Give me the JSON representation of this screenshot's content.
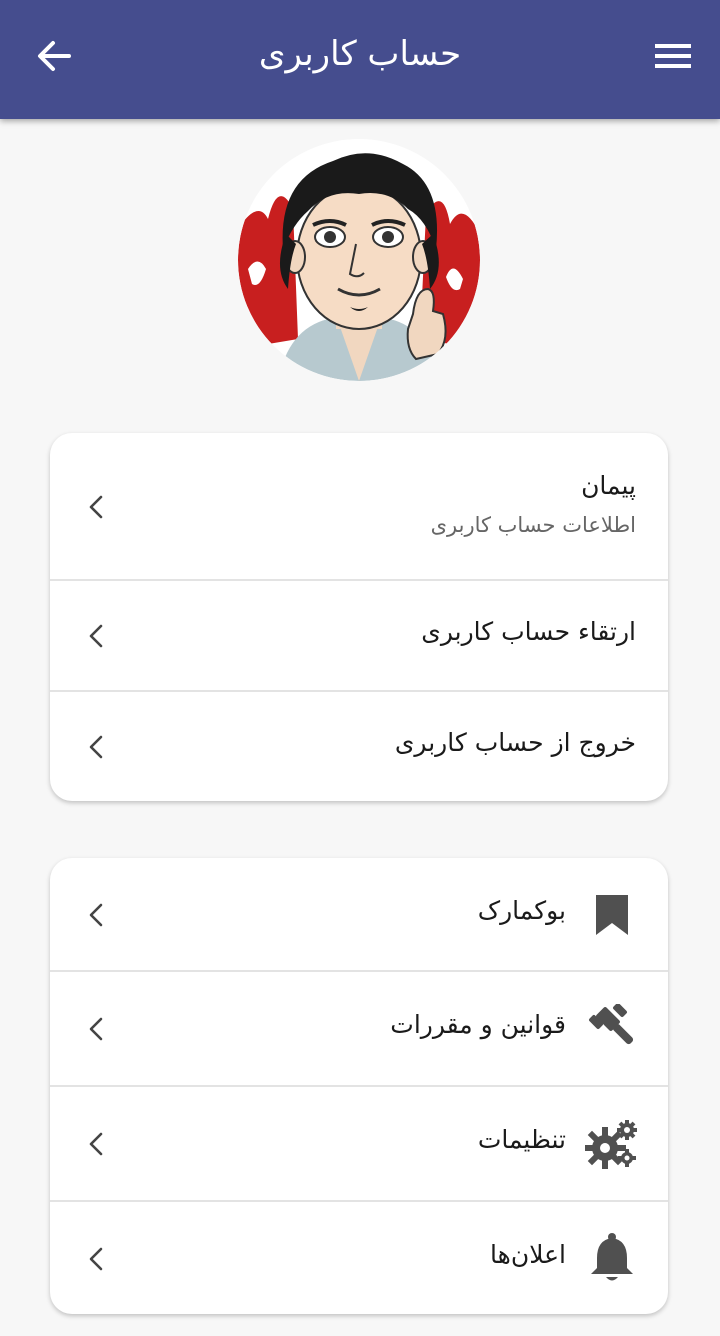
{
  "app": {
    "title": "حساب کاربری",
    "header_color": "#454d8e"
  },
  "header": {
    "back_icon": "arrow-left-icon",
    "menu_icon": "hamburger-menu-icon"
  },
  "profile": {
    "avatar": "cartoon-avatar"
  },
  "account_card": {
    "items": [
      {
        "label": "پیمان",
        "sublabel": "اطلاعات حساب کاربری",
        "chevron": "chevron-left-icon"
      },
      {
        "label": "ارتقاء حساب کاربری",
        "chevron": "chevron-left-icon"
      },
      {
        "label": "خروج از حساب کاربری",
        "chevron": "chevron-left-icon"
      }
    ]
  },
  "menu_card": {
    "items": [
      {
        "label": "بوکمارک",
        "icon": "bookmark-icon"
      },
      {
        "label": "قوانین و مقررات",
        "icon": "gavel-icon"
      },
      {
        "label": "تنظیمات",
        "icon": "gears-icon"
      },
      {
        "label": "اعلان‌ها",
        "icon": "bell-icon"
      }
    ]
  }
}
